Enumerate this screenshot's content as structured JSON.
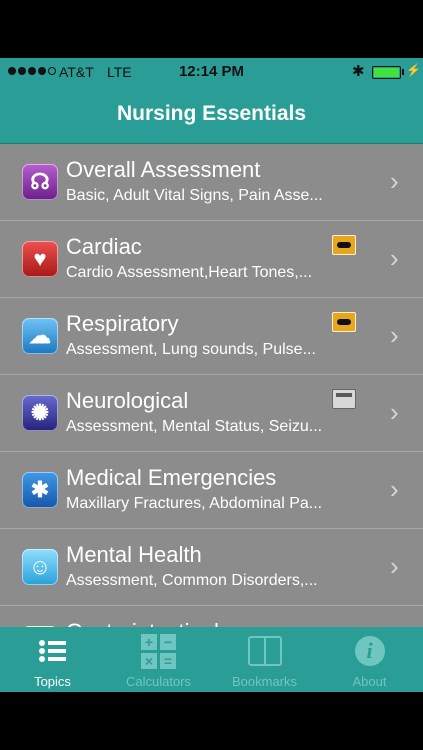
{
  "status_bar": {
    "carrier": "AT&T",
    "network": "LTE",
    "time": "12:14 PM"
  },
  "nav": {
    "title": "Nursing Essentials"
  },
  "topics": [
    {
      "title": "Overall Assessment",
      "subtitle": "Basic, Adult Vital Signs, Pain Asse...",
      "icon": "stethoscope-icon",
      "glyph": "☊",
      "badge": null
    },
    {
      "title": "Cardiac",
      "subtitle": "Cardio Assessment,Heart Tones,...",
      "icon": "heart-icon",
      "glyph": "♥",
      "badge": "video-icon"
    },
    {
      "title": "Respiratory",
      "subtitle": "Assessment, Lung sounds, Pulse...",
      "icon": "lungs-icon",
      "glyph": "☁",
      "badge": "video-icon"
    },
    {
      "title": "Neurological",
      "subtitle": "Assessment, Mental Status, Seizu...",
      "icon": "brain-icon",
      "glyph": "✺",
      "badge": "calculator-icon"
    },
    {
      "title": "Medical Emergencies",
      "subtitle": "Maxillary Fractures, Abdominal Pa...",
      "icon": "star-of-life-icon",
      "glyph": "✱",
      "badge": null
    },
    {
      "title": "Mental Health",
      "subtitle": "Assessment, Common Disorders,...",
      "icon": "chat-heads-icon",
      "glyph": "☺",
      "badge": null
    },
    {
      "title": "Gastrointestinal",
      "subtitle": "",
      "icon": "stomach-icon",
      "glyph": "",
      "badge": null
    }
  ],
  "tabs": [
    {
      "label": "Topics",
      "icon": "list-icon",
      "active": true
    },
    {
      "label": "Calculators",
      "icon": "calculator-icon",
      "active": false
    },
    {
      "label": "Bookmarks",
      "icon": "book-icon",
      "active": false
    },
    {
      "label": "About",
      "icon": "info-icon",
      "active": false
    }
  ],
  "tab_glyphs": {
    "plus": "+",
    "minus": "−",
    "times": "×",
    "equals": "=",
    "info": "i"
  },
  "colors": {
    "accent": "#2a9d96",
    "row_bg": "#8c8c8c",
    "tab_inactive": "#6fc6c1"
  }
}
